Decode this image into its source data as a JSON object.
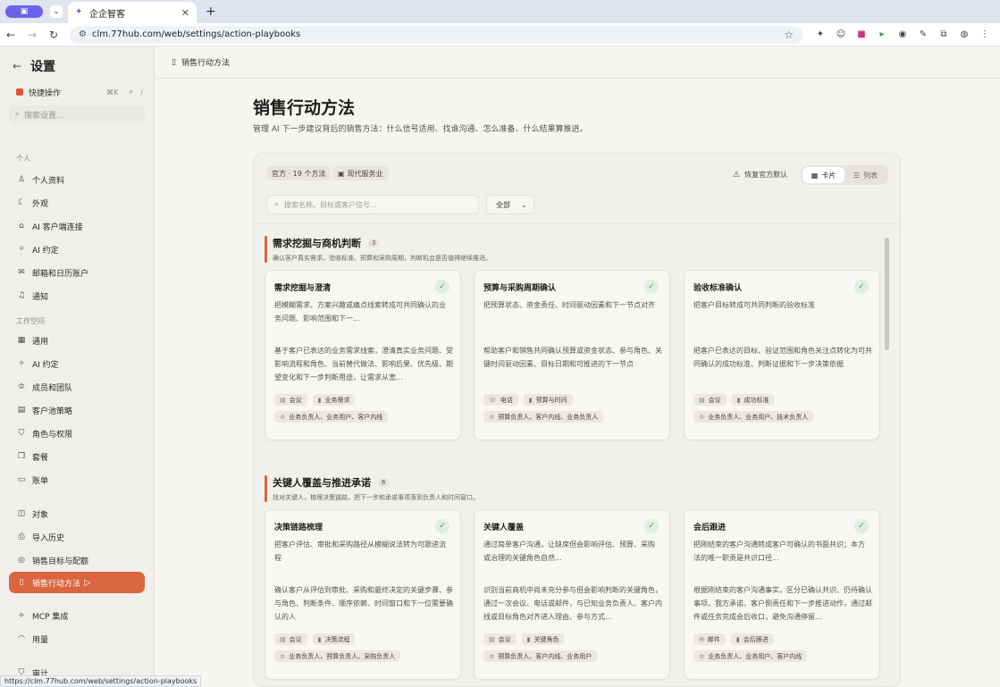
{
  "browser": {
    "tab_title": "企企智客",
    "url": "clm.77hub.com/web/settings/action-playbooks",
    "status_url": "https://clm.77hub.com/web/settings/action-playbooks"
  },
  "sidebar": {
    "title": "设置",
    "quick_actions": "快捷操作",
    "quick_kbd": "⌘K",
    "quick_slash": "/",
    "search_placeholder": "搜索设置...",
    "section_personal": "个人",
    "section_workspace": "工作空间",
    "personal_items": [
      {
        "label": "个人资料",
        "icon": "user-icon"
      },
      {
        "label": "外观",
        "icon": "moon-icon"
      },
      {
        "label": "AI 客户端连接",
        "icon": "plug-icon"
      },
      {
        "label": "AI 约定",
        "icon": "sparkle-icon"
      },
      {
        "label": "邮箱和日历账户",
        "icon": "mail-icon"
      },
      {
        "label": "通知",
        "icon": "bell-icon"
      }
    ],
    "workspace_items": [
      {
        "label": "通用",
        "icon": "grid-icon"
      },
      {
        "label": "AI 约定",
        "icon": "sparkle-icon"
      },
      {
        "label": "成员和团队",
        "icon": "team-icon"
      },
      {
        "label": "客户池策略",
        "icon": "pool-icon"
      },
      {
        "label": "角色与权限",
        "icon": "shield-icon"
      },
      {
        "label": "套餐",
        "icon": "package-icon"
      },
      {
        "label": "账单",
        "icon": "card-icon"
      }
    ],
    "other_items": [
      {
        "label": "对象",
        "icon": "objects-icon"
      },
      {
        "label": "导入历史",
        "icon": "import-icon"
      },
      {
        "label": "销售目标与配额",
        "icon": "target-icon"
      },
      {
        "label": "销售行动方法",
        "icon": "book-icon"
      },
      {
        "label": "MCP 集成",
        "icon": "mcp-icon"
      },
      {
        "label": "用量",
        "icon": "gauge-icon"
      },
      {
        "label": "审计",
        "icon": "audit-icon"
      }
    ]
  },
  "topbar": {
    "crumb": "销售行动方法"
  },
  "page": {
    "title": "销售行动方法",
    "description": "管理 AI 下一步建议背后的销售方法：什么信号适用、找谁沟通、怎么准备、什么结果算推进。",
    "chip_official": "官方 · 19 个方法",
    "chip_industry": "现代服务业",
    "reset_label": "恢复官方默认",
    "view_card": "卡片",
    "view_list": "列表",
    "search_placeholder": "搜索名称、目标或客户信号...",
    "filter_value": "全部"
  },
  "groups": [
    {
      "title": "需求挖掘与商机判断",
      "count": "3",
      "description": "确认客户真实需求、验收标准、预算和采购周期，判断机会是否值得继续推进。",
      "cards": [
        {
          "title": "需求挖掘与澄清",
          "desc": "把模糊需求、方案兴趣或痛点线索转成可共同确认的业务问题、影响范围和下一...",
          "body": "基于客户已表达的业务需求线索，澄清真实业务问题、受影响流程和角色、当前替代做法、影响后果、优先级、期望变化和下一步判断用途，让需求从宽...",
          "tags": [
            {
              "label": "会议",
              "icon": "calendar-icon"
            },
            {
              "label": "业务需求",
              "icon": "signal-icon"
            }
          ],
          "roles": "业务负责人、业务用户、客户内线"
        },
        {
          "title": "预算与采购周期确认",
          "desc": "把预算状态、资金责任、时间驱动因素和下一节点对齐",
          "body": "帮助客户和销售共同确认预算或资金状态、参与角色、关键时间驱动因素、目标日期和可推进的下一节点",
          "tags": [
            {
              "label": "电话",
              "icon": "phone-icon"
            },
            {
              "label": "预算与时间",
              "icon": "signal-icon"
            }
          ],
          "roles": "预算负责人、客户内线、业务负责人"
        },
        {
          "title": "验收标准确认",
          "desc": "把客户目标转成可共同判断的验收标准",
          "body": "把客户已表达的目标、验证范围和角色关注点转化为可共同确认的成功标准、判断证据和下一步决策依据",
          "tags": [
            {
              "label": "会议",
              "icon": "calendar-icon"
            },
            {
              "label": "成功标准",
              "icon": "signal-icon"
            }
          ],
          "roles": "业务负责人、业务用户、技术负责人"
        }
      ]
    },
    {
      "title": "关键人覆盖与推进承诺",
      "count": "6",
      "description": "找对关键人，梳理决策链路，把下一步和承诺事项落到负责人和时间窗口。",
      "cards": [
        {
          "title": "决策链路梳理",
          "desc": "把客户评估、审批和采购路径从模糊说法转为可跟进流程",
          "body": "确认客户从评估到审批、采购和最终决定的关键步骤、参与角色、判断条件、顺序依赖、时间窗口和下一位需要确认的人",
          "tags": [
            {
              "label": "会议",
              "icon": "calendar-icon"
            },
            {
              "label": "决策流程",
              "icon": "signal-icon"
            }
          ],
          "roles": "业务负责人、预算负责人、采购负责人"
        },
        {
          "title": "关键人覆盖",
          "desc": "通过简单客户沟通，让缺席但会影响评估、预算、采购或治理的关键角色自然...",
          "body": "识别当前商机中尚未充分参与但会影响判断的关键角色，通过一次会议、电话或邮件，与已知业务负责人、客户内线或目标角色对齐进入理由、参与方式...",
          "tags": [
            {
              "label": "会议",
              "icon": "calendar-icon"
            },
            {
              "label": "关键角色",
              "icon": "signal-icon"
            }
          ],
          "roles": "预算负责人、客户内线、业务用户"
        },
        {
          "title": "会后跟进",
          "desc": "把刚结束的客户沟通转成客户可确认的书面共识；本方法的唯一职责是共识口径...",
          "body": "根据刚结束的客户沟通事实，区分已确认共识、仍待确认事项、我方承诺、客户侧责任和下一步推进动作，通过邮件或任务完成会后收口，避免沟通停留...",
          "tags": [
            {
              "label": "邮件",
              "icon": "mail-icon"
            },
            {
              "label": "会后跟进",
              "icon": "signal-icon"
            }
          ],
          "roles": "业务负责人、业务用户、客户内线"
        }
      ]
    }
  ]
}
